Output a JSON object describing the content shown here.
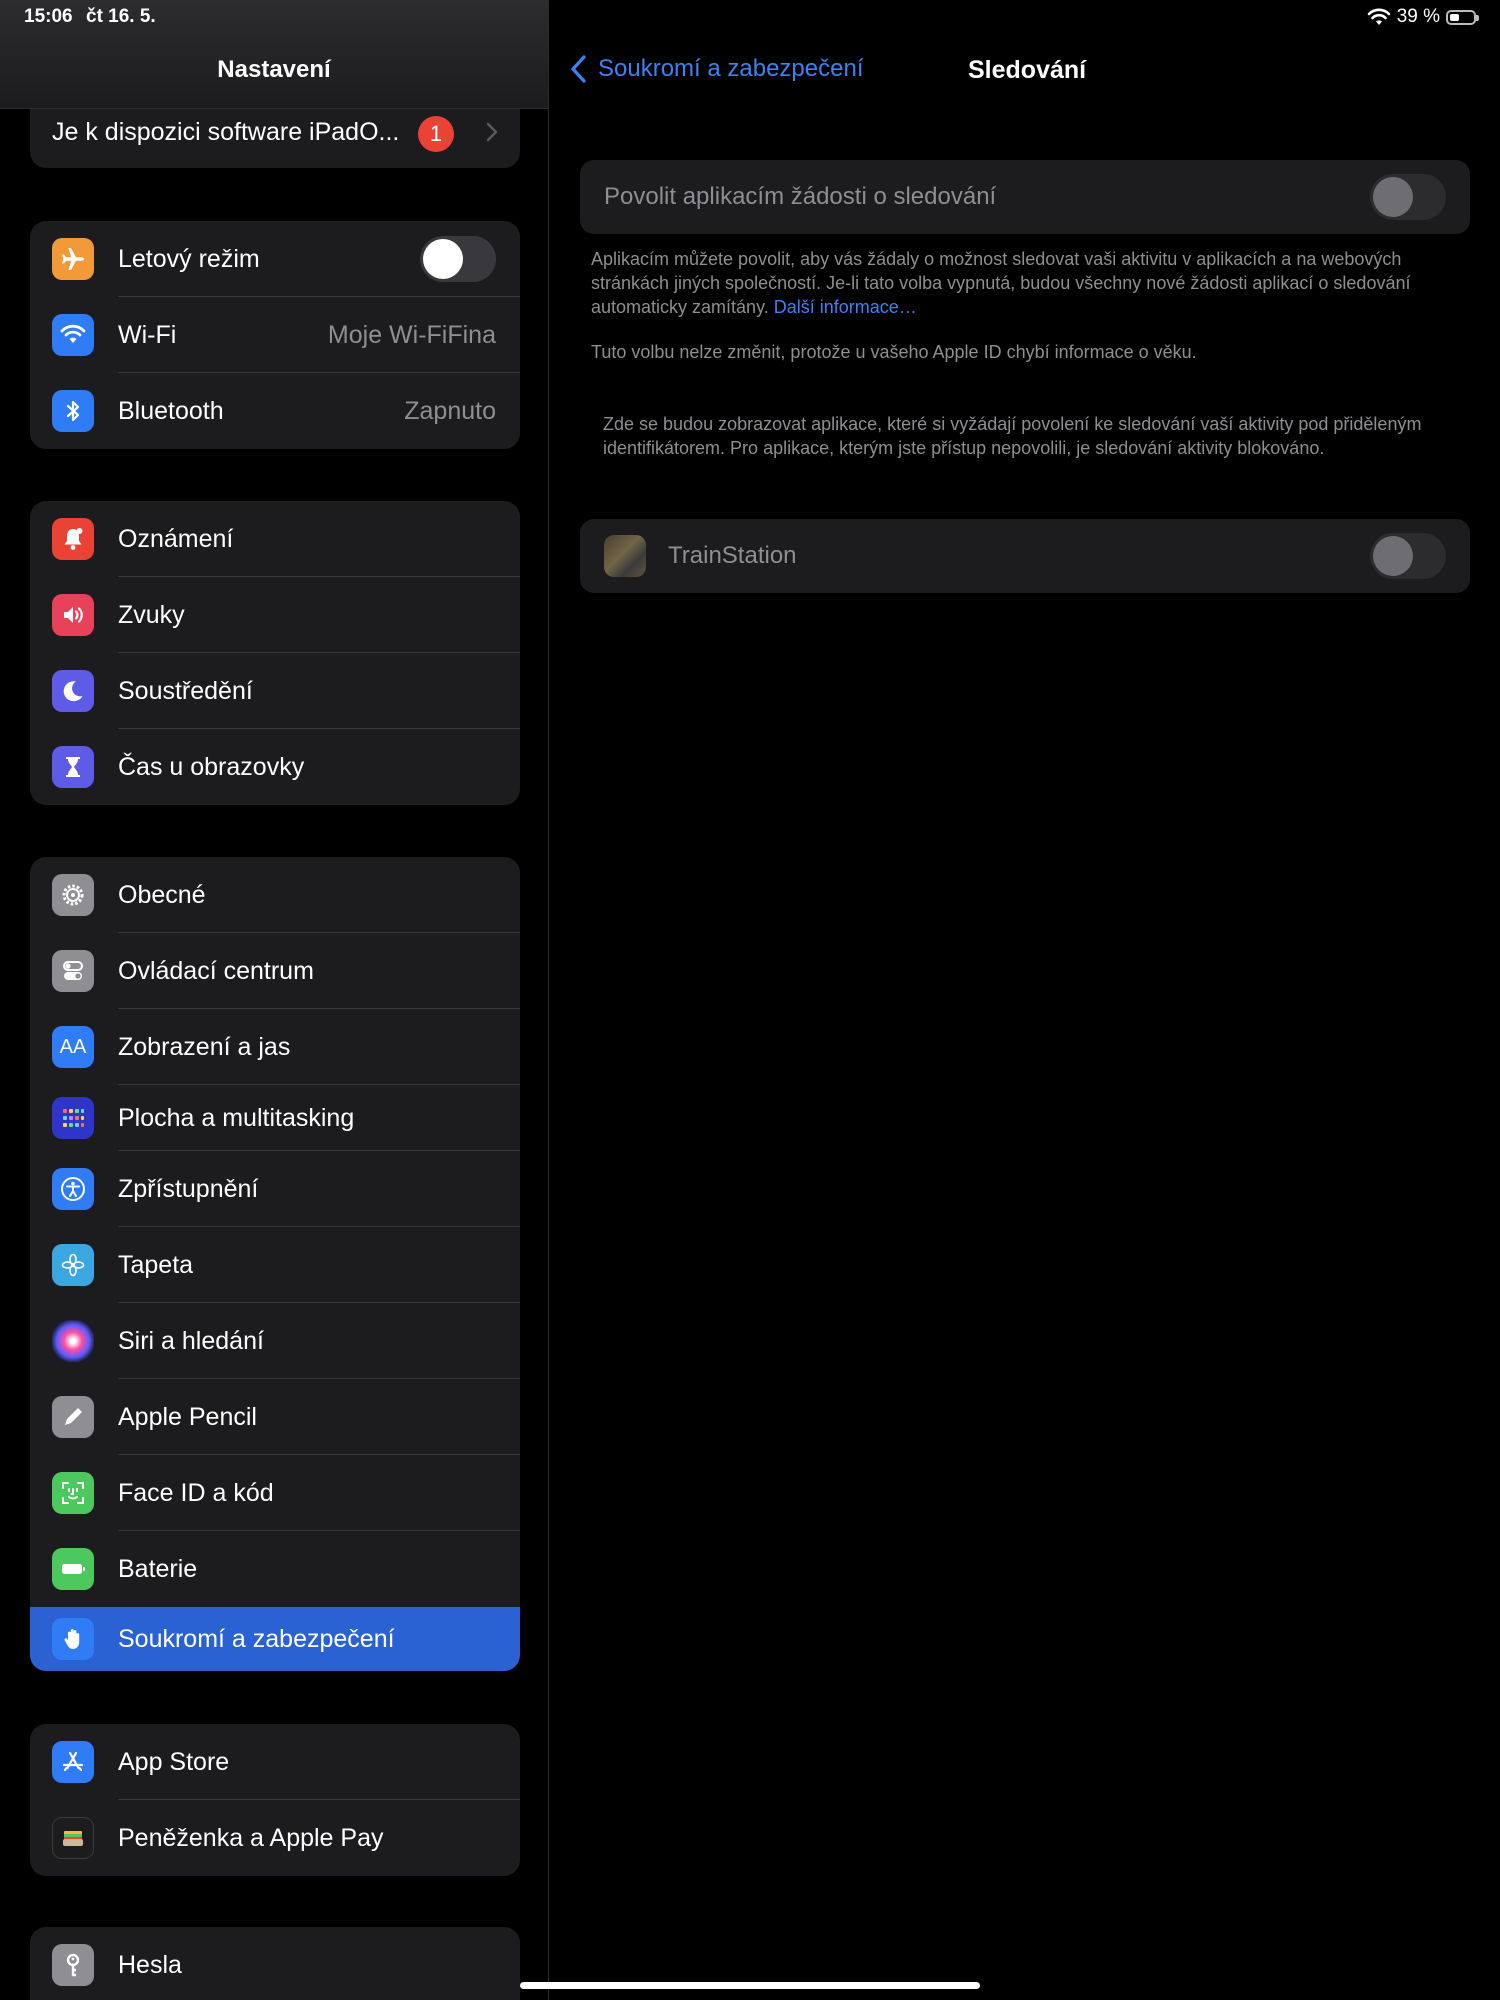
{
  "status": {
    "time": "15:06",
    "date": "čt 16. 5.",
    "battery": "39 %",
    "battery_level": 0.39
  },
  "sidebar": {
    "title": "Nastavení",
    "update": {
      "label": "Je k dispozici software iPadO...",
      "badge": "1"
    },
    "group1": [
      {
        "label": "Letový režim",
        "icon": "airplane-icon",
        "toggle": false
      },
      {
        "label": "Wi-Fi",
        "icon": "wifi-icon",
        "value": "Moje Wi-FiFina"
      },
      {
        "label": "Bluetooth",
        "icon": "bluetooth-icon",
        "value": "Zapnuto"
      }
    ],
    "group2": [
      {
        "label": "Oznámení",
        "icon": "bell-icon"
      },
      {
        "label": "Zvuky",
        "icon": "speaker-icon"
      },
      {
        "label": "Soustředění",
        "icon": "moon-icon"
      },
      {
        "label": "Čas u obrazovky",
        "icon": "hourglass-icon"
      }
    ],
    "group3": [
      {
        "label": "Obecné",
        "icon": "gear-icon"
      },
      {
        "label": "Ovládací centrum",
        "icon": "switches-icon"
      },
      {
        "label": "Zobrazení a jas",
        "icon": "text-size-icon",
        "icon_text": "AA"
      },
      {
        "label": "Plocha a multitasking",
        "icon": "grid-icon"
      },
      {
        "label": "Zpřístupnění",
        "icon": "accessibility-icon"
      },
      {
        "label": "Tapeta",
        "icon": "flower-icon"
      },
      {
        "label": "Siri a hledání",
        "icon": "siri-icon"
      },
      {
        "label": "Apple Pencil",
        "icon": "pencil-icon"
      },
      {
        "label": "Face ID a kód",
        "icon": "face-id-icon"
      },
      {
        "label": "Baterie",
        "icon": "battery-icon"
      },
      {
        "label": "Soukromí a zabezpečení",
        "icon": "hand-icon",
        "selected": true
      }
    ],
    "group4": [
      {
        "label": "App Store",
        "icon": "app-store-icon"
      },
      {
        "label": "Peněženka a Apple Pay",
        "icon": "wallet-icon"
      }
    ],
    "group5": [
      {
        "label": "Hesla",
        "icon": "key-icon"
      }
    ]
  },
  "detail": {
    "back_label": "Soukromí a zabezpečení",
    "title": "Sledování",
    "allow_label": "Povolit aplikacím žádosti o sledování",
    "allow_toggle": false,
    "desc1": "Aplikacím můžete povolit, aby vás žádaly o možnost sledovat vaši aktivitu v aplikacích a na webových stránkách jiných společností. Je-li tato volba vypnutá, budou všechny nové žádosti aplikací o sledování automaticky zamítány.",
    "desc1_link": "Další informace…",
    "desc2": "Tuto volbu nelze změnit, protože u vašeho Apple ID chybí informace o věku.",
    "desc3": "Zde se budou zobrazovat aplikace, které si vyžádají povolení ke sledování vaší aktivity pod přiděleným identifikátorem. Pro aplikace, kterým jste přístup nepovolili, je sledování aktivity blokováno.",
    "app": {
      "name": "TrainStation",
      "toggle": false
    }
  },
  "colors": {
    "accent": "#3b82f6",
    "selected": "#2a62d4",
    "orange": "#f19a37",
    "blue": "#2f7cf6",
    "red": "#eb4236",
    "pink": "#e8415a",
    "purple": "#5e5ce6",
    "gray": "#8e8e93",
    "green": "#4cc85f"
  }
}
